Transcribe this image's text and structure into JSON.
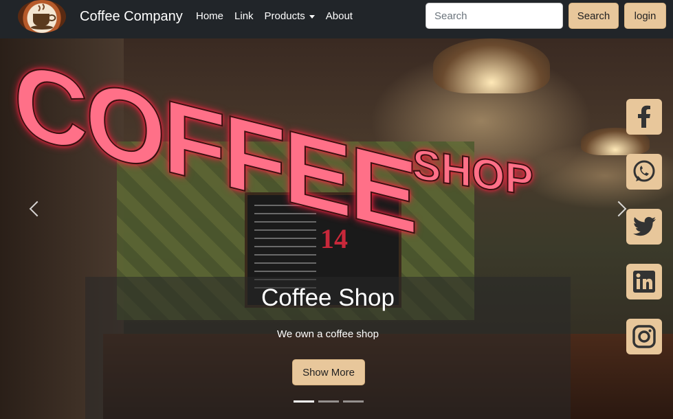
{
  "navbar": {
    "brand": "Coffee Company",
    "links": [
      "Home",
      "Link",
      "Products",
      "About"
    ],
    "search_placeholder": "Search",
    "search_button": "Search",
    "login_button": "login"
  },
  "hero": {
    "caption_title": "Coffee Shop",
    "caption_text": "We own a coffee shop",
    "button_label": "Show More",
    "slide_count": 3,
    "active_slide": 1,
    "sign_text_coffee": "COFFEE",
    "sign_text_shop": "SHOP",
    "board_number": "14"
  },
  "social": [
    "facebook-icon",
    "whatsapp-icon",
    "twitter-icon",
    "linkedin-icon",
    "instagram-icon"
  ],
  "colors": {
    "accent": "#e8c79b",
    "navbar_bg": "#212529"
  }
}
